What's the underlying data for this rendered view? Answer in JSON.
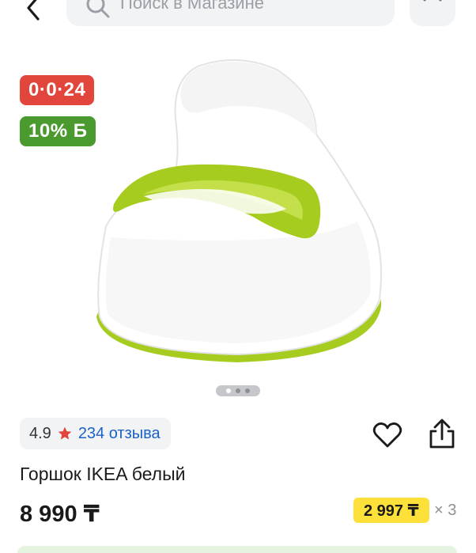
{
  "search": {
    "placeholder": "Поиск в Магазине"
  },
  "badges": {
    "installment": "0·0·24",
    "bonus": "10% Б"
  },
  "product": {
    "title": "Горшок IKEA белый",
    "price": "8 990 ₸",
    "rating": "4.9",
    "reviews": "234 отзыва",
    "installment_payment": "2 997 ₸",
    "installment_multiplier": "× 3"
  },
  "gallery": {
    "count": 3,
    "active_index": 0
  },
  "colors": {
    "accent_red": "#e2453c",
    "accent_green": "#4a9a2f",
    "link_blue": "#1a62c7",
    "installment_yellow": "#fde13a",
    "product_green": "#a6cc1f"
  },
  "icons": {
    "back": "chevron-left-icon",
    "search": "search-icon",
    "close": "close-icon",
    "star": "star-icon",
    "favorite": "heart-icon",
    "share": "share-icon"
  }
}
